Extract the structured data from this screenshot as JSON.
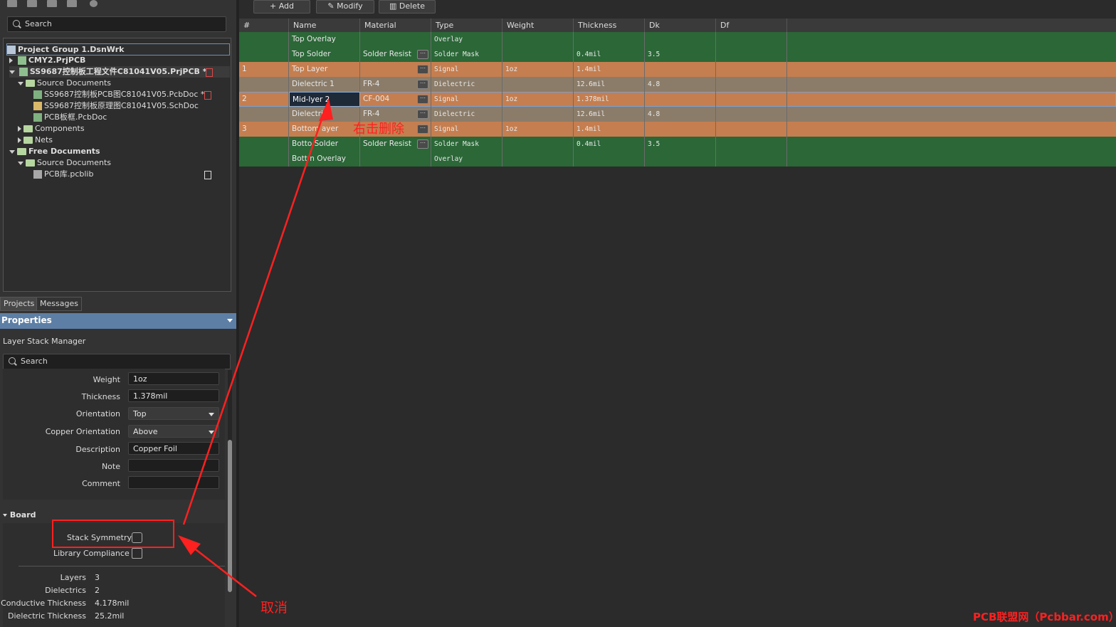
{
  "projects_panel": {
    "search_placeholder": "Search",
    "tree": [
      {
        "label": "Project Group 1.DsnWrk"
      },
      {
        "label": "CMY2.PrjPCB"
      },
      {
        "label": "SS9687控制板工程文件C81041V05.PrjPCB *"
      },
      {
        "label": "Source Documents"
      },
      {
        "label": "SS9687控制板PCB图C81041V05.PcbDoc *"
      },
      {
        "label": "SS9687控制板原理图C81041V05.SchDoc"
      },
      {
        "label": "PCB板框.PcbDoc"
      },
      {
        "label": "Components"
      },
      {
        "label": "Nets"
      },
      {
        "label": "Free Documents"
      },
      {
        "label": "Source Documents"
      },
      {
        "label": "PCB库.pcblib"
      }
    ],
    "tabs": [
      "Projects",
      "Messages"
    ]
  },
  "properties": {
    "title": "Properties",
    "subtitle": "Layer Stack Manager",
    "search_placeholder": "Search",
    "fields": {
      "weight_label": "Weight",
      "weight_value": "1oz",
      "thickness_label": "Thickness",
      "thickness_value": "1.378mil",
      "orientation_label": "Orientation",
      "orientation_value": "Top",
      "copper_orientation_label": "Copper Orientation",
      "copper_orientation_value": "Above",
      "description_label": "Description",
      "description_value": "Copper Foil",
      "note_label": "Note",
      "note_value": "",
      "comment_label": "Comment",
      "comment_value": ""
    },
    "board": {
      "section_label": "Board",
      "stack_symmetry_label": "Stack Symmetry",
      "stack_symmetry_checked": false,
      "library_compliance_label": "Library Compliance",
      "library_compliance_checked": false,
      "layers_label": "Layers",
      "layers_value": "3",
      "dielectrics_label": "Dielectrics",
      "dielectrics_value": "2",
      "conductive_thickness_label": "Conductive Thickness",
      "conductive_thickness_value": "4.178mil",
      "dielectric_thickness_label": "Dielectric Thickness",
      "dielectric_thickness_value": "25.2mil"
    }
  },
  "toolbar": {
    "add_label": "Add",
    "modify_label": "Modify",
    "delete_label": "Delete"
  },
  "grid": {
    "headers": [
      "#",
      "Name",
      "Material",
      "Type",
      "Weight",
      "Thickness",
      "Dk",
      "Df"
    ],
    "rows": [
      {
        "num": "",
        "name": "Top Overlay",
        "material": "",
        "type": "Overlay",
        "weight": "",
        "thickness": "",
        "dk": "",
        "df": "",
        "color": "green",
        "more": false
      },
      {
        "num": "",
        "name": "Top Solder",
        "material": "Solder Resist",
        "type": "Solder Mask",
        "weight": "",
        "thickness": "0.4mil",
        "dk": "3.5",
        "df": "",
        "color": "green",
        "more": true
      },
      {
        "num": "1",
        "name": "Top Layer",
        "material": "",
        "type": "Signal",
        "weight": "1oz",
        "thickness": "1.4mil",
        "dk": "",
        "df": "",
        "color": "orange",
        "more": true
      },
      {
        "num": "",
        "name": "Dielectric 1",
        "material": "FR-4",
        "type": "Dielectric",
        "weight": "",
        "thickness": "12.6mil",
        "dk": "4.8",
        "df": "",
        "color": "tan",
        "more": true
      },
      {
        "num": "2",
        "name": "Mid-lyer 2",
        "material": "CF-004",
        "type": "Signal",
        "weight": "1oz",
        "thickness": "1.378mil",
        "dk": "",
        "df": "",
        "color": "orange",
        "more": true,
        "selected": true
      },
      {
        "num": "",
        "name": "Dielectri",
        "material": "FR-4",
        "type": "Dielectric",
        "weight": "",
        "thickness": "12.6mil",
        "dk": "4.8",
        "df": "",
        "color": "tan",
        "more": true
      },
      {
        "num": "3",
        "name": "Bottom ayer",
        "material": "",
        "type": "Signal",
        "weight": "1oz",
        "thickness": "1.4mil",
        "dk": "",
        "df": "",
        "color": "orange",
        "more": true
      },
      {
        "num": "",
        "name": "Botto Solder",
        "material": "Solder Resist",
        "type": "Solder Mask",
        "weight": "",
        "thickness": "0.4mil",
        "dk": "3.5",
        "df": "",
        "color": "green",
        "more": true
      },
      {
        "num": "",
        "name": "Bott n Overlay",
        "material": "",
        "type": "Overlay",
        "weight": "",
        "thickness": "",
        "dk": "",
        "df": "",
        "color": "green",
        "more": false
      }
    ]
  },
  "annotations": {
    "right_click_delete": "右击删除",
    "cancel": "取消",
    "watermark": "PCB联盟网（Pcbbar.com）",
    "color": "#ff2020"
  }
}
